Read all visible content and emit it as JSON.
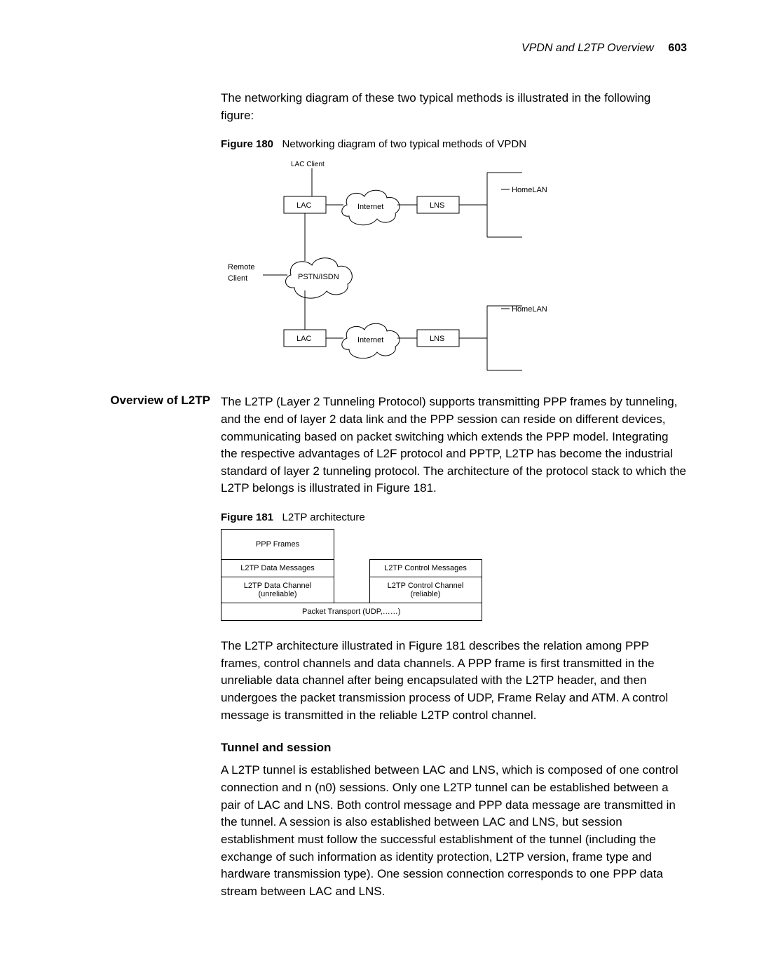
{
  "header": {
    "title": "VPDN and L2TP Overview",
    "page": "603"
  },
  "intro": {
    "p1": "The networking diagram of these two typical methods is illustrated in the following figure:"
  },
  "fig180": {
    "label": "Figure 180",
    "caption": "Networking diagram of two typical methods of VPDN",
    "labels": {
      "lac_client": "LAC Client",
      "lac": "LAC",
      "internet": "Internet",
      "lns": "LNS",
      "homelan": "HomeLAN",
      "remote": "Remote",
      "client": "Client",
      "pstn": "PSTN/ISDN"
    }
  },
  "overview": {
    "heading": "Overview of L2TP",
    "p1": "The L2TP (Layer 2 Tunneling Protocol) supports transmitting PPP frames by tunneling, and the end of layer 2 data link and the PPP session can reside on different devices, communicating based on packet switching which extends the PPP model. Integrating the respective advantages of L2F protocol and PPTP, L2TP has become the industrial standard of layer 2 tunneling protocol. The architecture of the protocol stack to which the L2TP belongs is illustrated in Figure 181."
  },
  "fig181": {
    "label": "Figure 181",
    "caption": "L2TP architecture",
    "cells": {
      "ppp": "PPP Frames",
      "data_msg": "L2TP Data Messages",
      "ctrl_msg": "L2TP Control Messages",
      "data_ch1": "L2TP Data Channel",
      "data_ch2": "(unreliable)",
      "ctrl_ch1": "L2TP Control Channel",
      "ctrl_ch2": "(reliable)",
      "transport": "Packet Transport (UDP,……)"
    }
  },
  "after181": {
    "p1": "The L2TP architecture illustrated in Figure 181 describes the relation among PPP frames, control channels and data channels. A PPP frame is first transmitted in the unreliable data channel after being encapsulated with the L2TP header, and then undergoes the packet transmission process of UDP, Frame Relay and ATM. A control message is transmitted in the reliable L2TP control channel."
  },
  "tunnel": {
    "heading": "Tunnel and session",
    "p1": "A L2TP tunnel is established between LAC and LNS, which is composed of one control connection and n (n0) sessions. Only one L2TP tunnel can be established between a pair of LAC and LNS. Both control message and PPP data message are transmitted in the tunnel. A session is also established between LAC and LNS, but session establishment must follow the successful establishment of the tunnel (including the exchange of such information as identity protection, L2TP version, frame type and hardware transmission type). One session connection corresponds to one PPP data stream between LAC and LNS."
  }
}
